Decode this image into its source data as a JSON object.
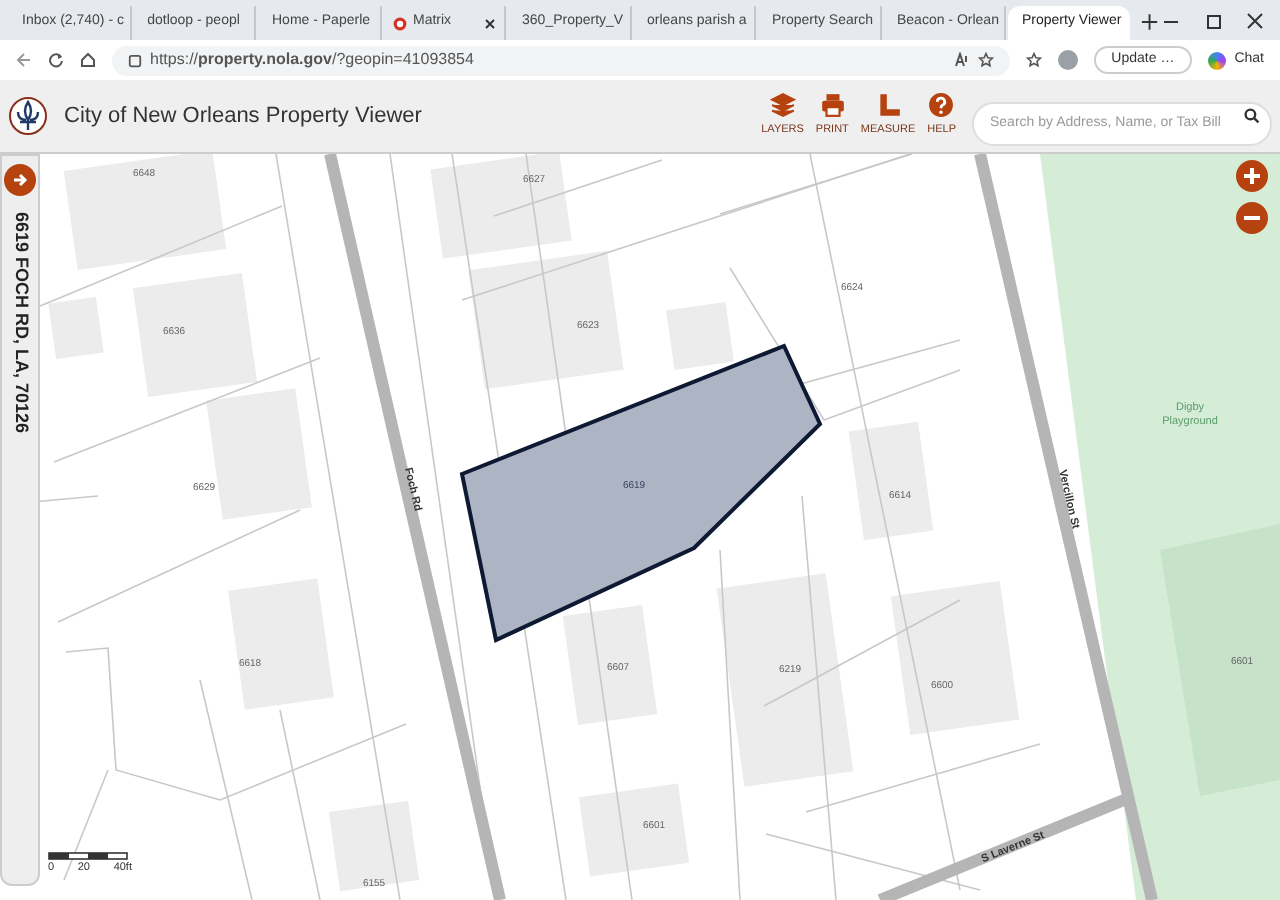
{
  "browser": {
    "tabs": [
      {
        "label": "Inbox (2,740) - c",
        "kind": "mail",
        "selected": false
      },
      {
        "label": "dotloop - peopl",
        "kind": "page",
        "selected": false
      },
      {
        "label": "Home - Paperle",
        "kind": "leaf",
        "selected": false
      },
      {
        "label": "Matrix",
        "kind": "ring",
        "selected": false
      },
      {
        "label": "360_Property_V",
        "kind": "pdf",
        "selected": false
      },
      {
        "label": "orleans parish a",
        "kind": "search",
        "selected": false
      },
      {
        "label": "Property Search",
        "kind": "bank",
        "selected": false
      },
      {
        "label": "Beacon - Orlean",
        "kind": "dot",
        "selected": false
      },
      {
        "label": "Property Viewer",
        "kind": "page",
        "selected": true
      }
    ],
    "address": "https://**property.nola.gov**/?geopin=41093854",
    "update_button": "Update …",
    "chat_button": "Chat"
  },
  "app": {
    "title": "City of New Orleans Property Viewer",
    "tools": [
      {
        "label": "LAYERS",
        "kind": "layers"
      },
      {
        "label": "PRINT",
        "kind": "print"
      },
      {
        "label": "MEASURE",
        "kind": "measure"
      },
      {
        "label": "HELP",
        "kind": "help"
      }
    ],
    "search": {
      "placeholder": "Search by Address, Name, or Tax Bill"
    }
  },
  "side_panel": {
    "address": "6619 FOCH RD, LA, 70126"
  },
  "map": {
    "parcels": [
      {
        "label": "6648",
        "selected": false
      },
      {
        "label": "6627",
        "selected": false
      },
      {
        "label": "6636",
        "selected": false
      },
      {
        "label": "6623",
        "selected": false
      },
      {
        "label": "6624",
        "selected": false
      },
      {
        "label": "6629",
        "selected": false
      },
      {
        "label": "6619",
        "selected": true
      },
      {
        "label": "6614",
        "selected": false
      },
      {
        "label": "6618",
        "selected": false
      },
      {
        "label": "6607",
        "selected": false
      },
      {
        "label": "6219",
        "selected": false
      },
      {
        "label": "6600",
        "selected": false
      },
      {
        "label": "6601",
        "selected": false
      },
      {
        "label": "6155",
        "selected": false
      },
      {
        "label": "6601",
        "selected": false
      }
    ],
    "streets": [
      "Foch Rd",
      "Vercillon St",
      "S Laverne St"
    ],
    "park": "Digby Playground",
    "scale": [
      "0",
      "20",
      "40ft"
    ]
  }
}
